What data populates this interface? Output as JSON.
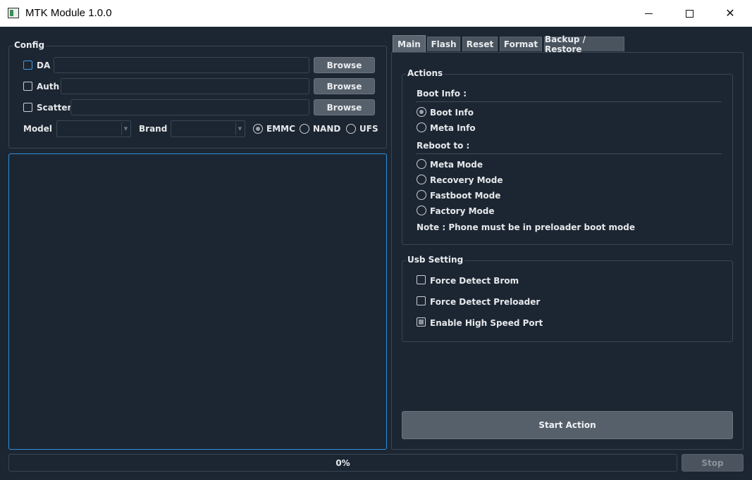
{
  "window": {
    "title": "MTK Module 1.0.0",
    "min_icon": "minimize-icon",
    "max_icon": "maximize-icon",
    "close_icon": "close-icon",
    "close_glyph": "✕"
  },
  "config": {
    "title": "Config",
    "da": {
      "label": "DA",
      "checked": false,
      "value": "",
      "browse": "Browse"
    },
    "auth": {
      "label": "Auth",
      "checked": false,
      "value": "",
      "browse": "Browse"
    },
    "scatter": {
      "label": "Scatter",
      "checked": false,
      "value": "",
      "browse": "Browse"
    },
    "model": {
      "label": "Model",
      "value": ""
    },
    "brand": {
      "label": "Brand",
      "value": ""
    },
    "storage": {
      "options": [
        "EMMC",
        "NAND",
        "UFS"
      ],
      "selected": "EMMC"
    }
  },
  "tabs": [
    {
      "label": "Main",
      "active": true
    },
    {
      "label": "Flash",
      "active": false
    },
    {
      "label": "Reset",
      "active": false
    },
    {
      "label": "Format",
      "active": false
    },
    {
      "label": "Backup / Restore",
      "active": false
    }
  ],
  "actions": {
    "title": "Actions",
    "boot_info_heading": "Boot Info :",
    "boot_info_options": [
      {
        "label": "Boot Info",
        "checked": true
      },
      {
        "label": "Meta Info",
        "checked": false
      }
    ],
    "reboot_heading": "Reboot to :",
    "reboot_options": [
      {
        "label": "Meta Mode",
        "checked": false
      },
      {
        "label": "Recovery Mode",
        "checked": false
      },
      {
        "label": "Fastboot Mode",
        "checked": false
      },
      {
        "label": "Factory Mode",
        "checked": false
      }
    ],
    "note": "Note : Phone must be in preloader boot mode"
  },
  "usb_setting": {
    "title": "Usb Setting",
    "options": [
      {
        "label": "Force Detect Brom",
        "checked": false
      },
      {
        "label": "Force Detect Preloader",
        "checked": false
      },
      {
        "label": "Enable High Speed Port",
        "checked": true
      }
    ]
  },
  "start_action": "Start Action",
  "progress": {
    "text": "0%",
    "value": 0
  },
  "stop": "Stop",
  "colors": {
    "background": "#1c2632",
    "accent": "#2e8fd8",
    "button": "#56606b"
  }
}
